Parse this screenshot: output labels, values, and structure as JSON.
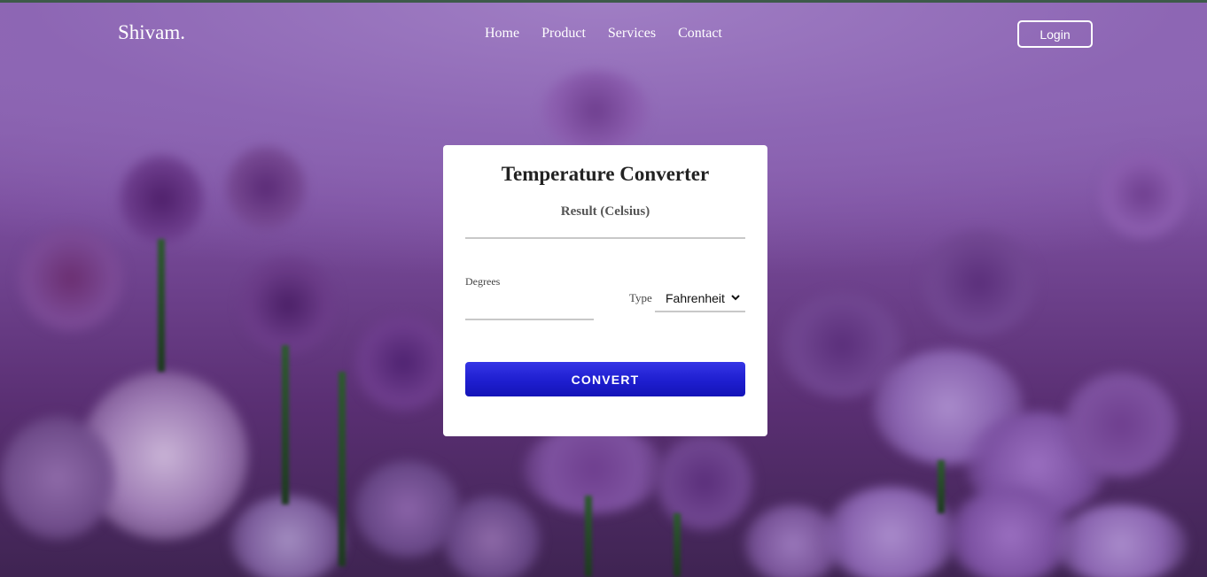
{
  "navbar": {
    "brand": "Shivam.",
    "links": [
      "Home",
      "Product",
      "Services",
      "Contact"
    ],
    "login_label": "Login"
  },
  "converter": {
    "title": "Temperature Converter",
    "result_label": "Result (Celsius)",
    "degrees_label": "Degrees",
    "degrees_value": "",
    "type_label": "Type",
    "type_selected": "Fahrenheit",
    "convert_label": "CONVERT"
  },
  "colors": {
    "accent": "#1e1ecf",
    "background_theme": "#8a5aa8",
    "card": "#ffffff"
  }
}
